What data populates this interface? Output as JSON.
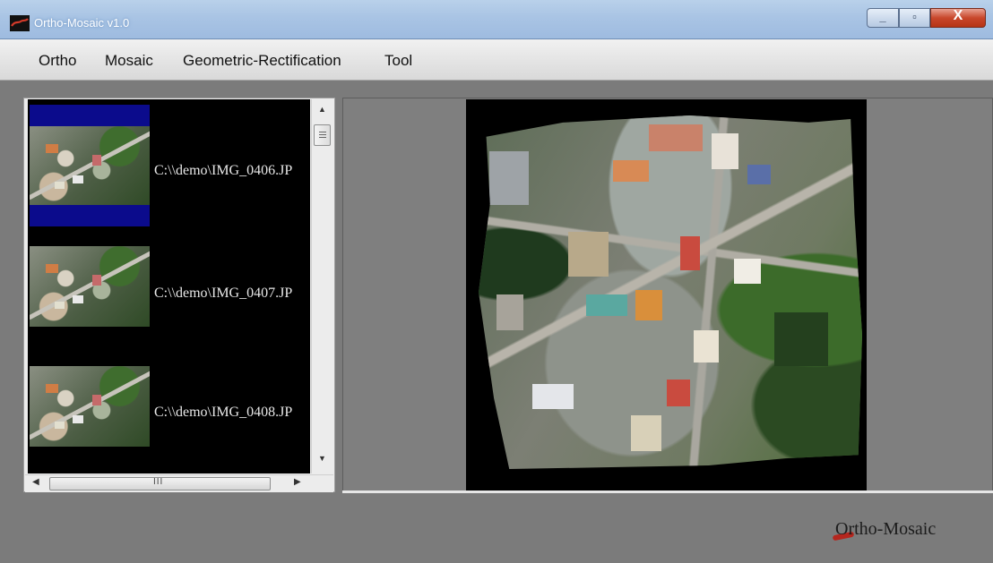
{
  "window": {
    "title": "Ortho-Mosaic v1.0",
    "buttons": {
      "minimize": "_",
      "maximize": "▫",
      "close": "X"
    }
  },
  "menu": {
    "items": [
      "Ortho",
      "Mosaic",
      "Geometric-Rectification",
      "Tool"
    ]
  },
  "image_list": {
    "items": [
      {
        "path": "C:\\\\demo\\IMG_0406.JP",
        "selected": true
      },
      {
        "path": "C:\\\\demo\\IMG_0407.JP",
        "selected": false
      },
      {
        "path": "C:\\\\demo\\IMG_0408.JP",
        "selected": false
      }
    ],
    "hscroll_grip": "III"
  },
  "branding": {
    "label": "Ortho-Mosaic"
  },
  "colors": {
    "selection": "#0b0b8c",
    "panel_bg": "#7b7b7b"
  }
}
